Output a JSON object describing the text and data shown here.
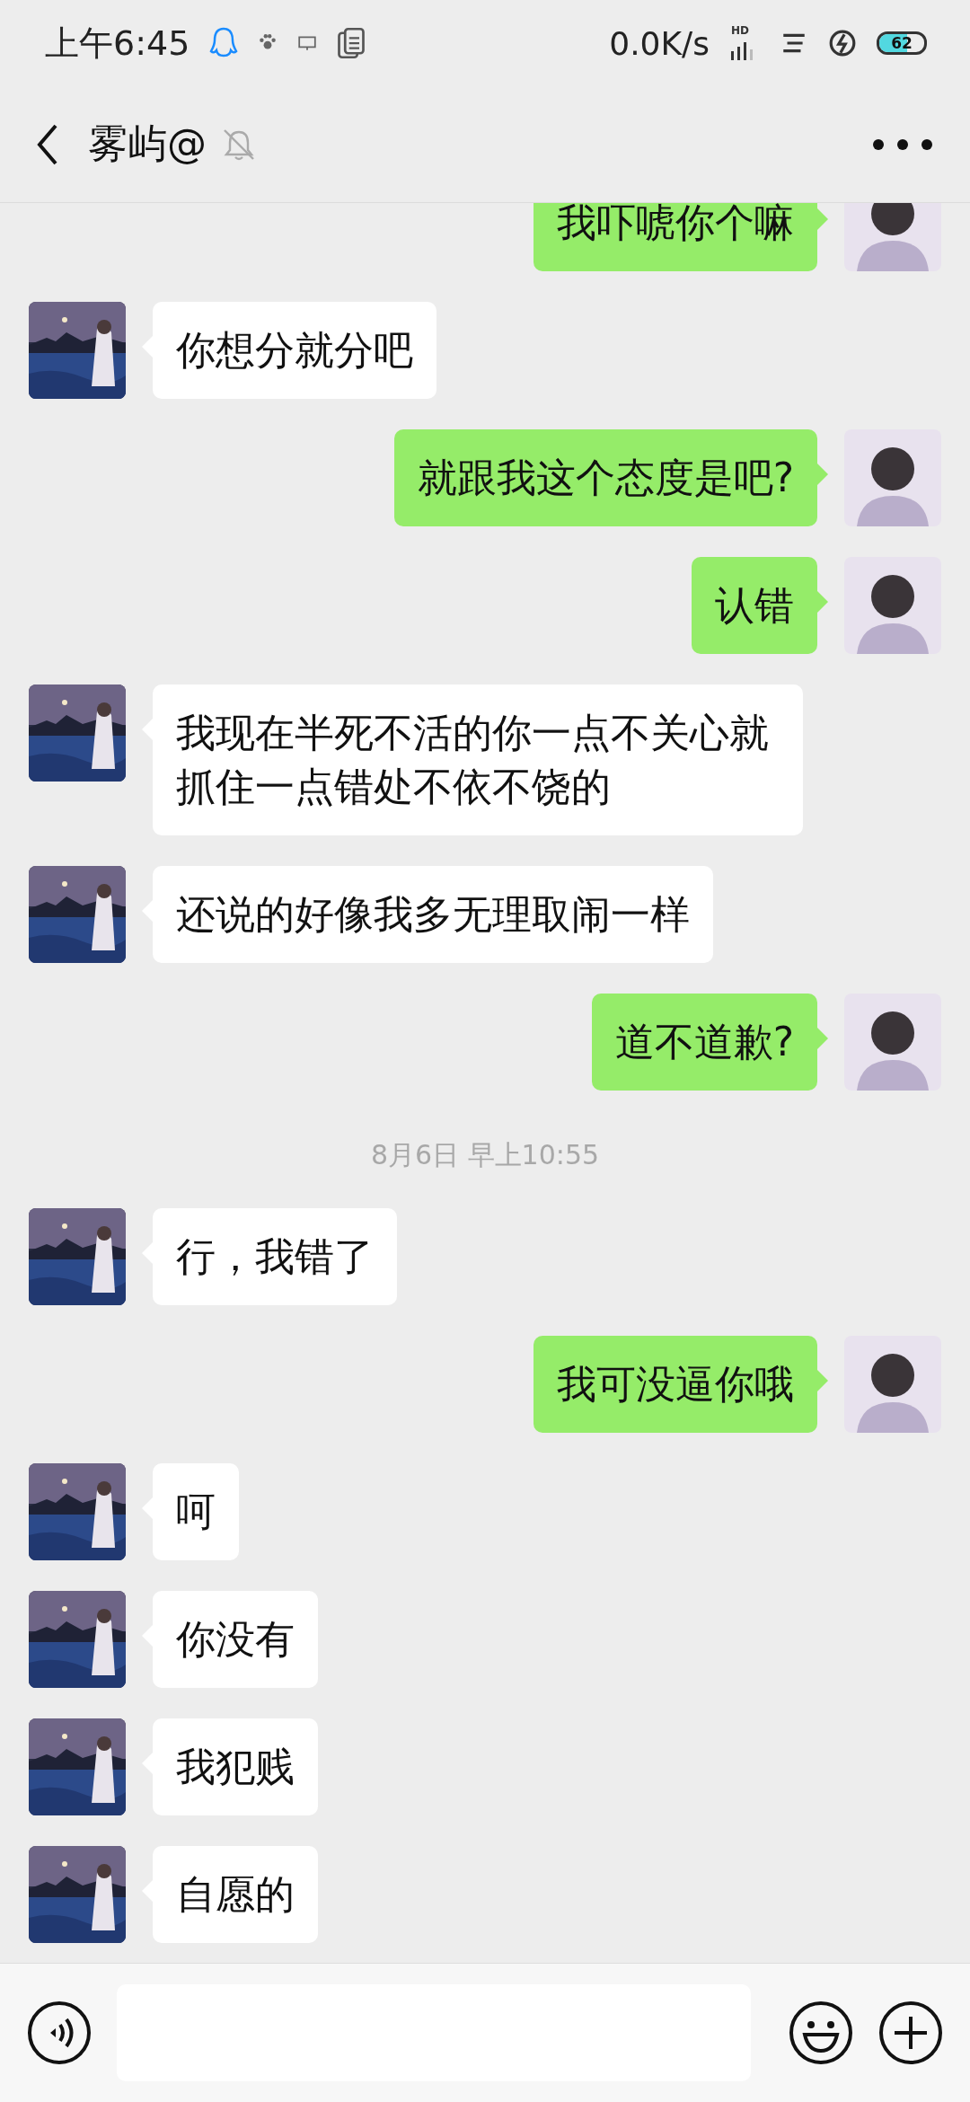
{
  "status_bar": {
    "time": "上午6:45",
    "net_speed": "0.0K/s",
    "signal_label": "HD",
    "battery": "62"
  },
  "header": {
    "title": "雾屿@",
    "muted": true
  },
  "messages": [
    {
      "kind": "sent",
      "text": "我吓唬你个嘛"
    },
    {
      "kind": "received",
      "text": "你想分就分吧"
    },
    {
      "kind": "sent",
      "text": "就跟我这个态度是吧?"
    },
    {
      "kind": "sent",
      "text": "认错"
    },
    {
      "kind": "received",
      "text": "我现在半死不活的你一点不关心就抓住一点错处不依不饶的"
    },
    {
      "kind": "received",
      "text": "还说的好像我多无理取闹一样"
    },
    {
      "kind": "sent",
      "text": "道不道歉?"
    },
    {
      "kind": "time",
      "text": "8月6日 早上10:55"
    },
    {
      "kind": "received",
      "text": "行，我错了"
    },
    {
      "kind": "sent",
      "text": "我可没逼你哦"
    },
    {
      "kind": "received",
      "text": "呵"
    },
    {
      "kind": "received",
      "text": "你没有"
    },
    {
      "kind": "received",
      "text": "我犯贱"
    },
    {
      "kind": "received",
      "text": "自愿的"
    }
  ]
}
